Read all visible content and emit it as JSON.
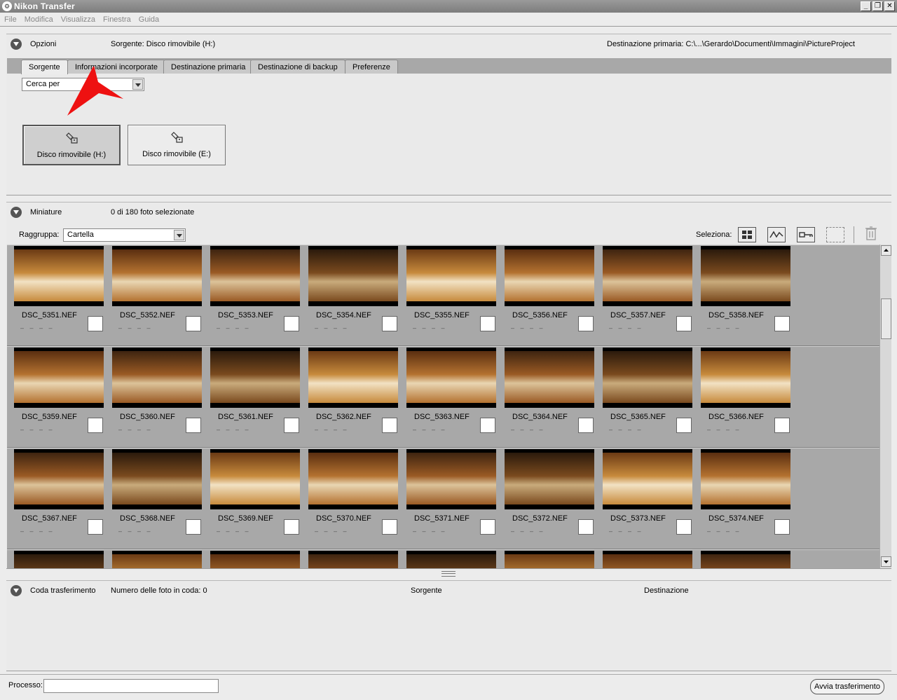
{
  "window": {
    "title": "Nikon Transfer",
    "controls": [
      "_",
      "❐",
      "✕"
    ]
  },
  "menu": [
    "File",
    "Modifica",
    "Visualizza",
    "Finestra",
    "Guida"
  ],
  "options": {
    "title": "Opzioni",
    "source_label": "Sorgente: Disco rimovibile (H:)",
    "destination_label": "Destinazione primaria: C:\\...\\Gerardo\\Documenti\\Immagini\\PictureProject",
    "tabs": [
      "Sorgente",
      "Informazioni incorporate",
      "Destinazione primaria",
      "Destinazione di backup",
      "Preferenze"
    ],
    "search_by": "Cerca per",
    "drives": [
      "Disco rimovibile (H:)",
      "Disco rimovibile (E:)"
    ]
  },
  "thumbnails": {
    "title": "Miniature",
    "selected_count": "0 di 180 foto selezionate",
    "group_label": "Raggruppa:",
    "group_value": "Cartella",
    "select_label": "Seleziona:",
    "photos": [
      "DSC_5351.NEF",
      "DSC_5352.NEF",
      "DSC_5353.NEF",
      "DSC_5354.NEF",
      "DSC_5355.NEF",
      "DSC_5356.NEF",
      "DSC_5357.NEF",
      "DSC_5358.NEF",
      "DSC_5359.NEF",
      "DSC_5360.NEF",
      "DSC_5361.NEF",
      "DSC_5362.NEF",
      "DSC_5363.NEF",
      "DSC_5364.NEF",
      "DSC_5365.NEF",
      "DSC_5366.NEF",
      "DSC_5367.NEF",
      "DSC_5368.NEF",
      "DSC_5369.NEF",
      "DSC_5370.NEF",
      "DSC_5371.NEF",
      "DSC_5372.NEF",
      "DSC_5373.NEF",
      "DSC_5374.NEF"
    ],
    "meta_placeholder": "– – – –"
  },
  "queue": {
    "title": "Coda trasferimento",
    "count_label": "Numero delle foto in coda: 0",
    "col_source": "Sorgente",
    "col_destination": "Destinazione"
  },
  "footer": {
    "process_label": "Processo:",
    "start_button": "Avvia trasferimento"
  },
  "colors": {
    "annotation_arrow": "#ee1111",
    "panel_bg": "#eaeaea",
    "thumb_bg": "#a8a8a8"
  }
}
